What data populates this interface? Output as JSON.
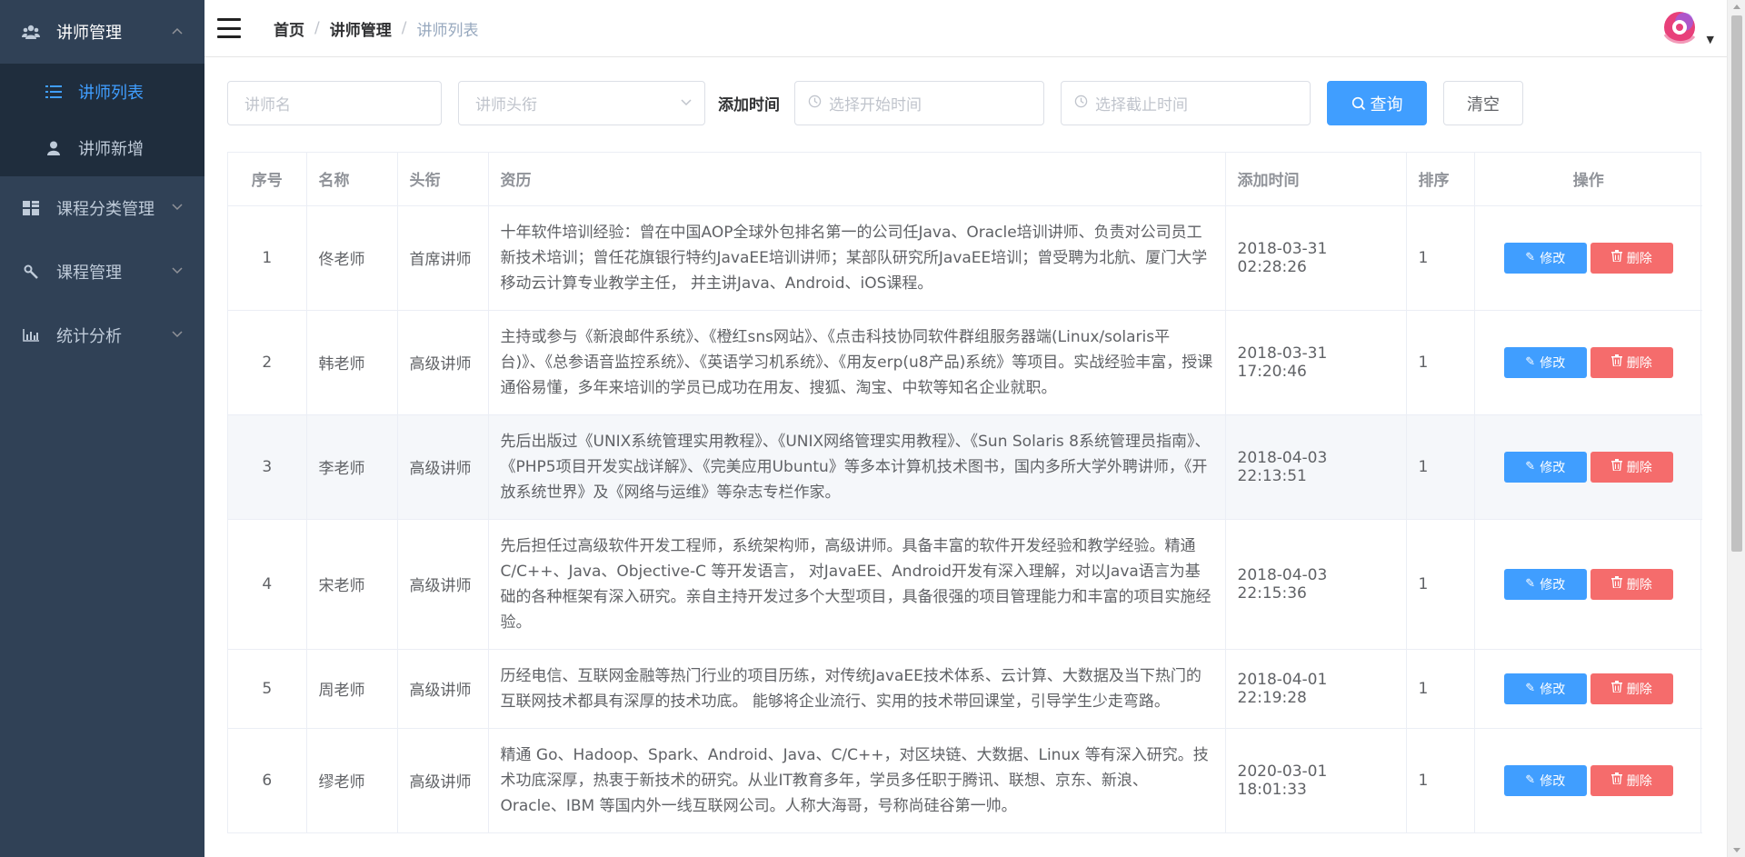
{
  "sidebar": {
    "groups": [
      {
        "label": "讲师管理",
        "icon": "users-icon",
        "open": true,
        "children": [
          {
            "label": "讲师列表",
            "icon": "list-icon",
            "active": true
          },
          {
            "label": "讲师新增",
            "icon": "user-icon",
            "active": false
          }
        ]
      },
      {
        "label": "课程分类管理",
        "icon": "grid-icon",
        "open": false
      },
      {
        "label": "课程管理",
        "icon": "magic-icon",
        "open": false
      },
      {
        "label": "统计分析",
        "icon": "chart-icon",
        "open": false
      }
    ]
  },
  "breadcrumb": [
    "首页",
    "讲师管理",
    "讲师列表"
  ],
  "search": {
    "name_placeholder": "讲师名",
    "level_placeholder": "讲师头衔",
    "time_label": "添加时间",
    "start_placeholder": "选择开始时间",
    "end_placeholder": "选择截止时间",
    "query_label": "查询",
    "clear_label": "清空"
  },
  "table": {
    "headers": [
      "序号",
      "名称",
      "头衔",
      "资历",
      "添加时间",
      "排序",
      "操作"
    ],
    "edit_label": "修改",
    "delete_label": "删除",
    "rows": [
      {
        "no": "1",
        "name": "佟老师",
        "level": "首席讲师",
        "intro": "十年软件培训经验：曾在中国AOP全球外包排名第一的公司任Java、Oracle培训讲师、负责对公司员工新技术培训；曾任花旗银行特约JavaEE培训讲师；某部队研究所JavaEE培训；曾受聘为北航、厦门大学移动云计算专业教学主任，  并主讲Java、Android、iOS课程。",
        "time": "2018-03-31 02:28:26",
        "sort": "1"
      },
      {
        "no": "2",
        "name": "韩老师",
        "level": "高级讲师",
        "intro": "主持或参与《新浪邮件系统》、《橙红sns网站》、《点击科技协同软件群组服务器端(Linux/solaris平台)》、《总参语音监控系统》、《英语学习机系统》、《用友erp(u8产品)系统》等项目。实战经验丰富，授课通俗易懂，多年来培训的学员已成功在用友、搜狐、淘宝、中软等知名企业就职。",
        "time": "2018-03-31 17:20:46",
        "sort": "1"
      },
      {
        "no": "3",
        "name": "李老师",
        "level": "高级讲师",
        "intro": "先后出版过《UNIX系统管理实用教程》、《UNIX网络管理实用教程》、《Sun Solaris 8系统管理员指南》、《PHP5项目开发实战详解》、《完美应用Ubuntu》等多本计算机技术图书，国内多所大学外聘讲师，《开放系统世界》及《网络与运维》等杂志专栏作家。",
        "time": "2018-04-03 22:13:51",
        "sort": "1"
      },
      {
        "no": "4",
        "name": "宋老师",
        "level": "高级讲师",
        "intro": "先后担任过高级软件开发工程师，系统架构师，高级讲师。具备丰富的软件开发经验和教学经验。精通C/C++、Java、Objective-C 等开发语言， 对JavaEE、Android开发有深入理解，对以Java语言为基础的各种框架有深入研究。亲自主持开发过多个大型项目，具备很强的项目管理能力和丰富的项目实施经验。",
        "time": "2018-04-03 22:15:36",
        "sort": "1"
      },
      {
        "no": "5",
        "name": "周老师",
        "level": "高级讲师",
        "intro": "历经电信、互联网金融等热门行业的项目历练，对传统JavaEE技术体系、云计算、大数据及当下热门的互联网技术都具有深厚的技术功底。 能够将企业流行、实用的技术带回课堂，引导学生少走弯路。",
        "time": "2018-04-01 22:19:28",
        "sort": "1"
      },
      {
        "no": "6",
        "name": "缪老师",
        "level": "高级讲师",
        "intro": "精通 Go、Hadoop、Spark、Android、Java、C/C++，对区块链、大数据、Linux 等有深入研究。技术功底深厚，热衷于新技术的研究。从业IT教育多年，学员多任职于腾讯、联想、京东、新浪、Oracle、IBM 等国内外一线互联网公司。人称大海哥，号称尚硅谷第一帅。",
        "time": "2020-03-01 18:01:33",
        "sort": "1"
      }
    ]
  },
  "colors": {
    "sidebar_bg": "#304156",
    "submenu_bg": "#1f2d3d",
    "primary": "#409eff",
    "danger": "#f56c6c"
  }
}
